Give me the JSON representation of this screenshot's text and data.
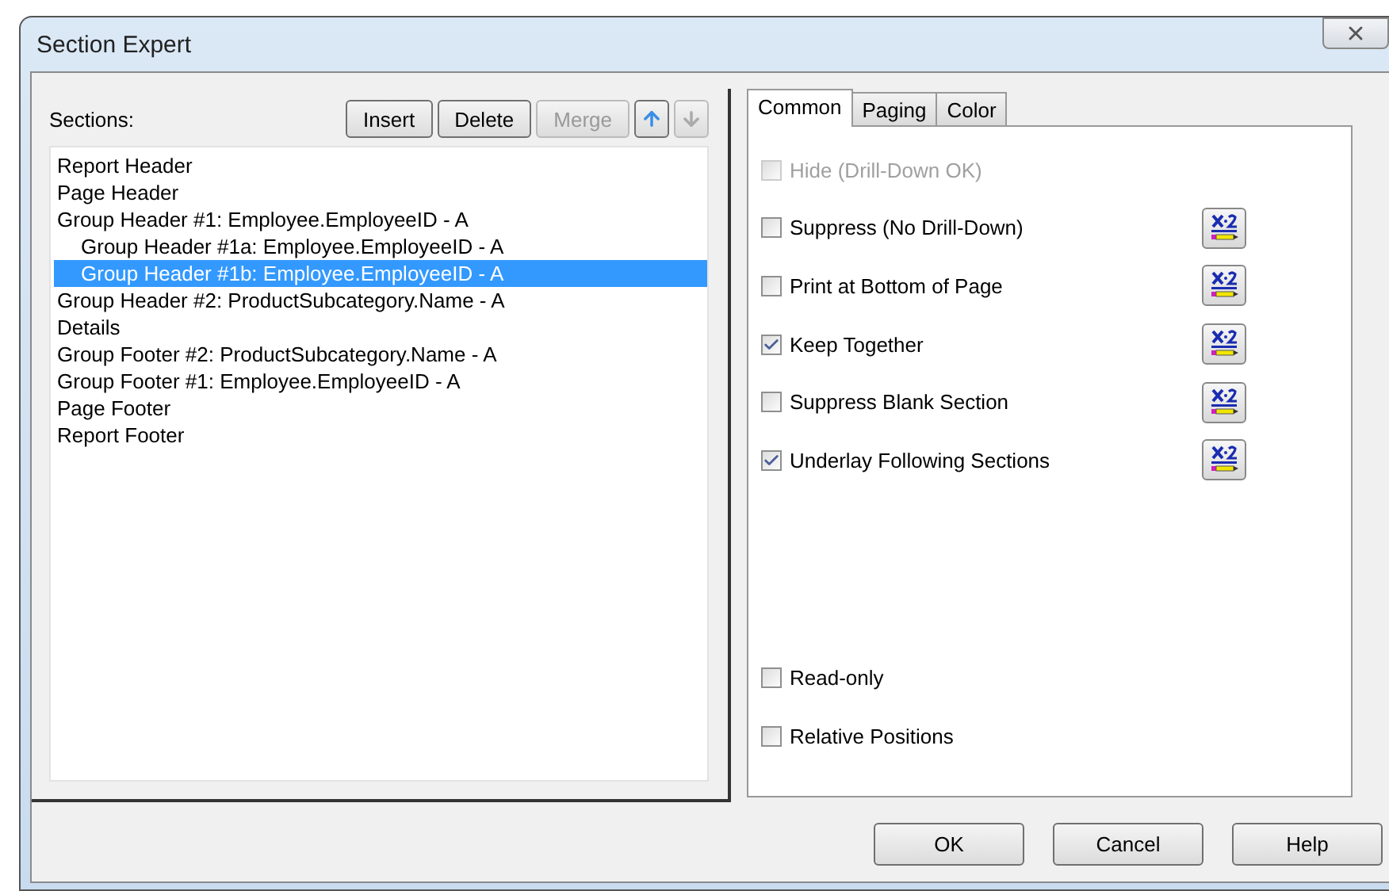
{
  "window": {
    "title": "Section Expert"
  },
  "sections": {
    "label": "Sections:",
    "buttons": [
      {
        "label": "Insert",
        "disabled": false
      },
      {
        "label": "Delete",
        "disabled": false
      },
      {
        "label": "Merge",
        "disabled": true
      }
    ],
    "move_up": {
      "disabled": false
    },
    "move_down": {
      "disabled": true
    },
    "items": [
      {
        "label": "Report Header",
        "selected": false
      },
      {
        "label": "Page Header",
        "selected": false
      },
      {
        "label": "Group Header #1: Employee.EmployeeID - A",
        "selected": false,
        "children": [
          {
            "label": "Group Header #1a: Employee.EmployeeID - A",
            "selected": false
          },
          {
            "label": "Group Header #1b: Employee.EmployeeID - A",
            "selected": true
          }
        ]
      },
      {
        "label": "Group Header #2: ProductSubcategory.Name - A",
        "selected": false
      },
      {
        "label": "Details",
        "selected": false
      },
      {
        "label": "Group Footer #2: ProductSubcategory.Name - A",
        "selected": false
      },
      {
        "label": "Group Footer #1: Employee.EmployeeID - A",
        "selected": false
      },
      {
        "label": "Page Footer",
        "selected": false
      },
      {
        "label": "Report Footer",
        "selected": false
      }
    ]
  },
  "tabs": [
    {
      "label": "Common",
      "selected": true
    },
    {
      "label": "Paging",
      "selected": false
    },
    {
      "label": "Color",
      "selected": false
    }
  ],
  "options": [
    {
      "label": "Hide (Drill-Down OK)",
      "checked": false,
      "disabled": true,
      "formula": false
    },
    {
      "label": "Suppress (No Drill-Down)",
      "checked": false,
      "disabled": false,
      "formula": true
    },
    {
      "label": "Print at Bottom of Page",
      "checked": false,
      "disabled": false,
      "formula": true
    },
    {
      "label": "Keep Together",
      "checked": true,
      "disabled": false,
      "formula": true
    },
    {
      "label": "Suppress Blank Section",
      "checked": false,
      "disabled": false,
      "formula": true
    },
    {
      "label": "Underlay Following Sections",
      "checked": true,
      "disabled": false,
      "formula": true
    }
  ],
  "bottom_options": [
    {
      "label": "Read-only",
      "checked": false
    },
    {
      "label": "Relative Positions",
      "checked": false
    }
  ],
  "buttons": [
    "OK",
    "Cancel",
    "Help"
  ]
}
